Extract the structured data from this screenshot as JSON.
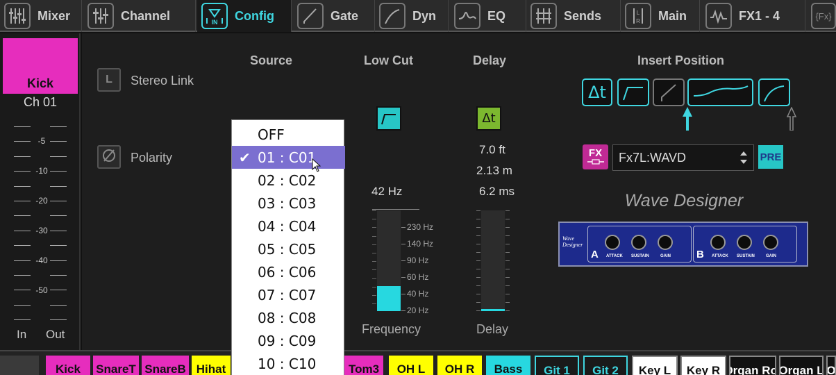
{
  "tabs": [
    {
      "label": "Mixer",
      "icon": "mixer-icon",
      "active": false
    },
    {
      "label": "Channel",
      "icon": "channel-icon",
      "active": false
    },
    {
      "label": "Config",
      "icon": "config-icon",
      "active": true
    },
    {
      "label": "Gate",
      "icon": "gate-icon",
      "active": false
    },
    {
      "label": "Dyn",
      "icon": "dynamics-icon",
      "active": false
    },
    {
      "label": "EQ",
      "icon": "eq-icon",
      "active": false
    },
    {
      "label": "Sends",
      "icon": "sends-icon",
      "active": false
    },
    {
      "label": "Main",
      "icon": "main-icon",
      "active": false
    },
    {
      "label": "FX1 - 4",
      "icon": "fx-icon",
      "active": false
    },
    {
      "label": "",
      "icon": "fx-icon",
      "active": false
    }
  ],
  "strip": {
    "name": "Kick",
    "number": "Ch 01",
    "color": "#e62dbd",
    "meter_labels": [
      "-5",
      "-10",
      "-20",
      "-30",
      "-40",
      "-50"
    ],
    "in_label": "In",
    "out_label": "Out"
  },
  "config": {
    "stereo_link_button": "L",
    "stereo_link_label": "Stereo Link",
    "polarity_label": "Polarity",
    "source_header": "Source",
    "lowcut_header": "Low Cut",
    "delay_header": "Delay",
    "insert_header": "Insert Position",
    "lowcut_freq": "42 Hz",
    "lowcut_scale": [
      "230 Hz",
      "140 Hz",
      "90 Hz",
      "60 Hz",
      "40 Hz",
      "20 Hz"
    ],
    "lowcut_footer": "Frequency",
    "lowcut_level": 0.25,
    "delay_ft": "7.0 ft",
    "delay_m": "2.13 m",
    "delay_ms": "6.2 ms",
    "delay_footer": "Delay",
    "delay_level": 0.02
  },
  "source_dropdown": {
    "items": [
      "OFF",
      "01 : C01",
      "02 : C02",
      "03 : C03",
      "04 : C04",
      "05 : C05",
      "06 : C06",
      "07 : C07",
      "08 : C08",
      "09 : C09",
      "10 : C10"
    ],
    "selected": "01 : C01",
    "check_glyph": "✔"
  },
  "insert": {
    "fx_icon_label": "FX",
    "fx_select_value": "Fx7L:WAVD",
    "pre_label": "PRE",
    "plugin_name": "Wave Designer",
    "plugin_panel_title": "Wave Designer",
    "plugin_sections": [
      "A",
      "B"
    ],
    "knob_labels": [
      "ATTACK",
      "SUSTAIN",
      "GAIN"
    ],
    "accent": "#3fd6e0"
  },
  "channels": [
    {
      "name": "",
      "color": "#3a3a3a",
      "text": "#ddd"
    },
    {
      "name": "Kick",
      "color": "#e62dbd",
      "text": "#111"
    },
    {
      "name": "SnareT",
      "color": "#e62dbd",
      "text": "#111"
    },
    {
      "name": "SnareB",
      "color": "#e62dbd",
      "text": "#111"
    },
    {
      "name": "Hihat",
      "color": "#ffff00",
      "text": "#111"
    },
    {
      "name": "Tom3",
      "color": "#e62dbd",
      "text": "#111"
    },
    {
      "name": "OH L",
      "color": "#ffff00",
      "text": "#111"
    },
    {
      "name": "OH R",
      "color": "#ffff00",
      "text": "#111"
    },
    {
      "name": "Bass",
      "color": "#27d8e0",
      "text": "#111"
    },
    {
      "name": "Git 1",
      "color": "#1a1a1a",
      "text": "#3fd6e0"
    },
    {
      "name": "Git 2",
      "color": "#1a1a1a",
      "text": "#3fd6e0"
    },
    {
      "name": "Key L",
      "color": "#ffffff",
      "text": "#111"
    },
    {
      "name": "Key R",
      "color": "#ffffff",
      "text": "#111"
    },
    {
      "name": "Organ Rot",
      "color": "#111111",
      "text": "#fff"
    },
    {
      "name": "Organ L",
      "color": "#111111",
      "text": "#fff"
    },
    {
      "name": "O",
      "color": "#111111",
      "text": "#fff"
    }
  ]
}
